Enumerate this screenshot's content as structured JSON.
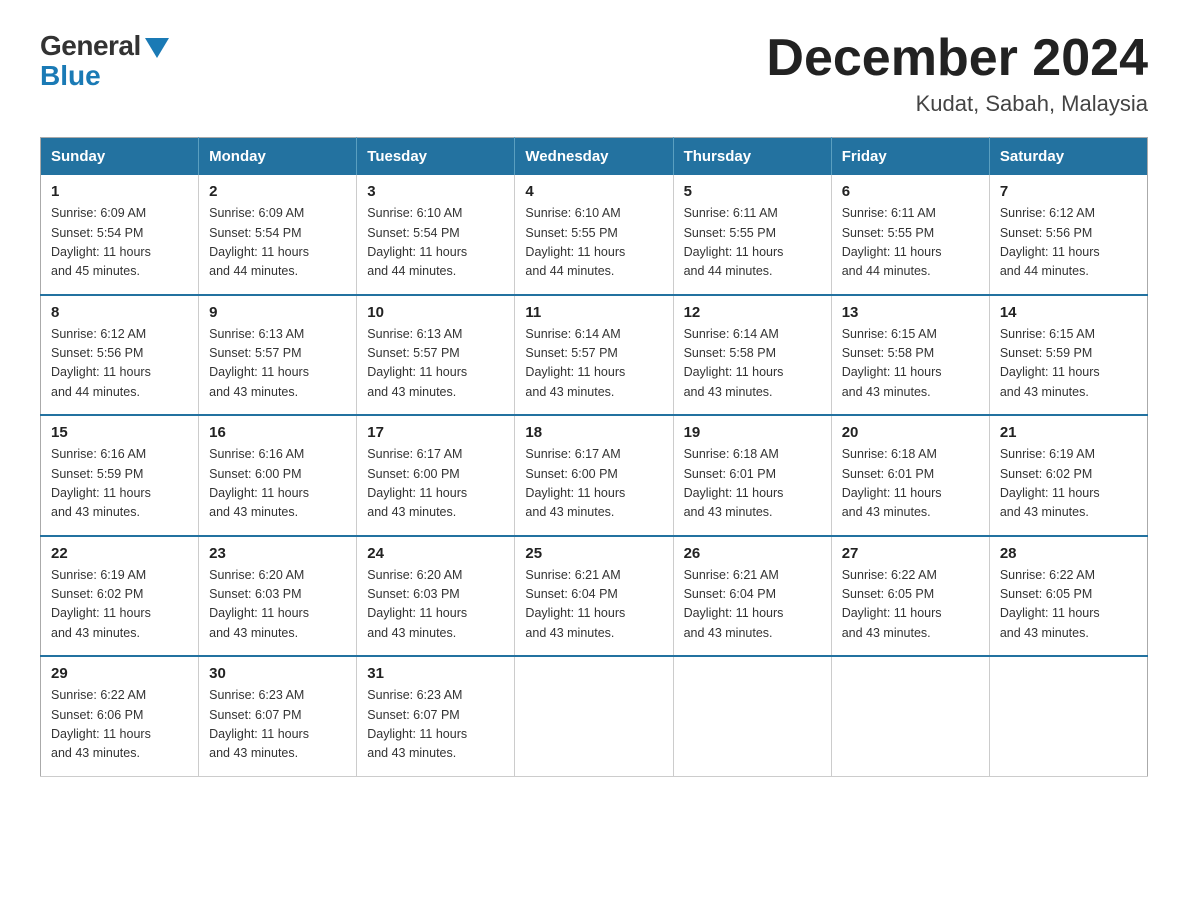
{
  "header": {
    "logo_general": "General",
    "logo_blue": "Blue",
    "month_title": "December 2024",
    "location": "Kudat, Sabah, Malaysia"
  },
  "calendar": {
    "days_of_week": [
      "Sunday",
      "Monday",
      "Tuesday",
      "Wednesday",
      "Thursday",
      "Friday",
      "Saturday"
    ],
    "weeks": [
      [
        {
          "day": "1",
          "sunrise": "6:09 AM",
          "sunset": "5:54 PM",
          "daylight": "11 hours and 45 minutes."
        },
        {
          "day": "2",
          "sunrise": "6:09 AM",
          "sunset": "5:54 PM",
          "daylight": "11 hours and 44 minutes."
        },
        {
          "day": "3",
          "sunrise": "6:10 AM",
          "sunset": "5:54 PM",
          "daylight": "11 hours and 44 minutes."
        },
        {
          "day": "4",
          "sunrise": "6:10 AM",
          "sunset": "5:55 PM",
          "daylight": "11 hours and 44 minutes."
        },
        {
          "day": "5",
          "sunrise": "6:11 AM",
          "sunset": "5:55 PM",
          "daylight": "11 hours and 44 minutes."
        },
        {
          "day": "6",
          "sunrise": "6:11 AM",
          "sunset": "5:55 PM",
          "daylight": "11 hours and 44 minutes."
        },
        {
          "day": "7",
          "sunrise": "6:12 AM",
          "sunset": "5:56 PM",
          "daylight": "11 hours and 44 minutes."
        }
      ],
      [
        {
          "day": "8",
          "sunrise": "6:12 AM",
          "sunset": "5:56 PM",
          "daylight": "11 hours and 44 minutes."
        },
        {
          "day": "9",
          "sunrise": "6:13 AM",
          "sunset": "5:57 PM",
          "daylight": "11 hours and 43 minutes."
        },
        {
          "day": "10",
          "sunrise": "6:13 AM",
          "sunset": "5:57 PM",
          "daylight": "11 hours and 43 minutes."
        },
        {
          "day": "11",
          "sunrise": "6:14 AM",
          "sunset": "5:57 PM",
          "daylight": "11 hours and 43 minutes."
        },
        {
          "day": "12",
          "sunrise": "6:14 AM",
          "sunset": "5:58 PM",
          "daylight": "11 hours and 43 minutes."
        },
        {
          "day": "13",
          "sunrise": "6:15 AM",
          "sunset": "5:58 PM",
          "daylight": "11 hours and 43 minutes."
        },
        {
          "day": "14",
          "sunrise": "6:15 AM",
          "sunset": "5:59 PM",
          "daylight": "11 hours and 43 minutes."
        }
      ],
      [
        {
          "day": "15",
          "sunrise": "6:16 AM",
          "sunset": "5:59 PM",
          "daylight": "11 hours and 43 minutes."
        },
        {
          "day": "16",
          "sunrise": "6:16 AM",
          "sunset": "6:00 PM",
          "daylight": "11 hours and 43 minutes."
        },
        {
          "day": "17",
          "sunrise": "6:17 AM",
          "sunset": "6:00 PM",
          "daylight": "11 hours and 43 minutes."
        },
        {
          "day": "18",
          "sunrise": "6:17 AM",
          "sunset": "6:00 PM",
          "daylight": "11 hours and 43 minutes."
        },
        {
          "day": "19",
          "sunrise": "6:18 AM",
          "sunset": "6:01 PM",
          "daylight": "11 hours and 43 minutes."
        },
        {
          "day": "20",
          "sunrise": "6:18 AM",
          "sunset": "6:01 PM",
          "daylight": "11 hours and 43 minutes."
        },
        {
          "day": "21",
          "sunrise": "6:19 AM",
          "sunset": "6:02 PM",
          "daylight": "11 hours and 43 minutes."
        }
      ],
      [
        {
          "day": "22",
          "sunrise": "6:19 AM",
          "sunset": "6:02 PM",
          "daylight": "11 hours and 43 minutes."
        },
        {
          "day": "23",
          "sunrise": "6:20 AM",
          "sunset": "6:03 PM",
          "daylight": "11 hours and 43 minutes."
        },
        {
          "day": "24",
          "sunrise": "6:20 AM",
          "sunset": "6:03 PM",
          "daylight": "11 hours and 43 minutes."
        },
        {
          "day": "25",
          "sunrise": "6:21 AM",
          "sunset": "6:04 PM",
          "daylight": "11 hours and 43 minutes."
        },
        {
          "day": "26",
          "sunrise": "6:21 AM",
          "sunset": "6:04 PM",
          "daylight": "11 hours and 43 minutes."
        },
        {
          "day": "27",
          "sunrise": "6:22 AM",
          "sunset": "6:05 PM",
          "daylight": "11 hours and 43 minutes."
        },
        {
          "day": "28",
          "sunrise": "6:22 AM",
          "sunset": "6:05 PM",
          "daylight": "11 hours and 43 minutes."
        }
      ],
      [
        {
          "day": "29",
          "sunrise": "6:22 AM",
          "sunset": "6:06 PM",
          "daylight": "11 hours and 43 minutes."
        },
        {
          "day": "30",
          "sunrise": "6:23 AM",
          "sunset": "6:07 PM",
          "daylight": "11 hours and 43 minutes."
        },
        {
          "day": "31",
          "sunrise": "6:23 AM",
          "sunset": "6:07 PM",
          "daylight": "11 hours and 43 minutes."
        },
        null,
        null,
        null,
        null
      ]
    ],
    "labels": {
      "sunrise": "Sunrise:",
      "sunset": "Sunset:",
      "daylight": "Daylight:"
    }
  }
}
